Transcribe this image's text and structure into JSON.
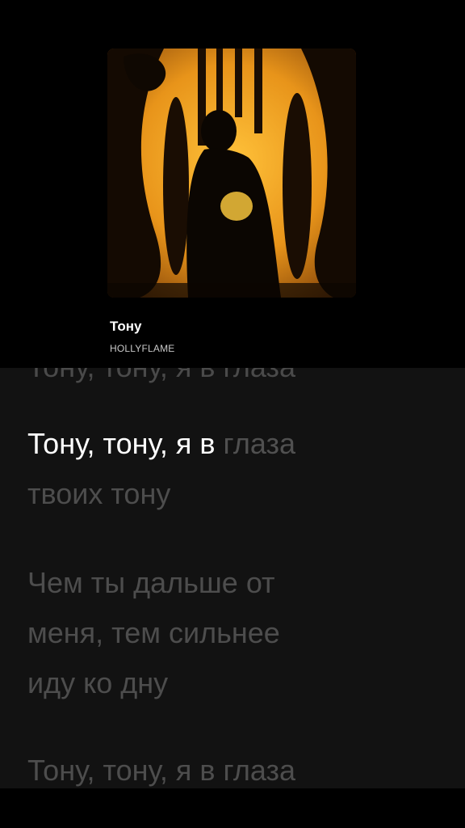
{
  "track": {
    "title": "Тону",
    "artist": "HOLLYFLAME"
  },
  "lyrics": {
    "active_sung": "Тону, тону, я в ",
    "active_remaining": "глаза",
    "line1_cont": "твоих тону",
    "line2": [
      "Чем ты дальше от",
      "меня, тем сильнее",
      "иду ко дну"
    ],
    "line3": "Тону, тону, я в глаза"
  },
  "colors": {
    "background": "#121212",
    "cover_accent": "#f0a21a",
    "sung_text": "#ffffff",
    "unsung_text": "#505050"
  }
}
